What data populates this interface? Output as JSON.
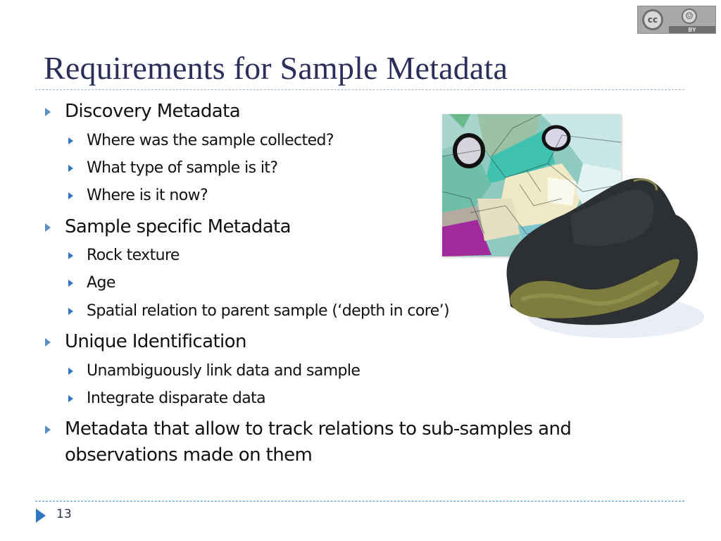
{
  "license_badge": {
    "label": "BY",
    "cc_label": "cc",
    "icon": "creative-commons-by-icon"
  },
  "slide": {
    "title": "Requirements for Sample Metadata",
    "bullets": [
      {
        "level": 1,
        "text": "Discovery Metadata"
      },
      {
        "level": 2,
        "text": "Where was the sample collected?"
      },
      {
        "level": 2,
        "text": "What type of sample is it?"
      },
      {
        "level": 2,
        "text": "Where is it now?"
      },
      {
        "level": 1,
        "text": "Sample specific Metadata"
      },
      {
        "level": 2,
        "text": "Rock texture"
      },
      {
        "level": 2,
        "text": "Age"
      },
      {
        "level": 2,
        "text": "Spatial relation to parent sample (‘depth in core’)"
      },
      {
        "level": 1,
        "text": "Unique Identification"
      },
      {
        "level": 2,
        "text": "Unambiguously link data and sample"
      },
      {
        "level": 2,
        "text": "Integrate disparate data"
      },
      {
        "level": 1,
        "text": "Metadata that allow to track relations to sub-samples and"
      },
      {
        "level": 1,
        "text": "observations made on them",
        "continuation": true
      }
    ],
    "images": [
      {
        "name": "thin-section-micrograph",
        "description": "Colorful polarized-light thin section of rock"
      },
      {
        "name": "rock-sample-photo",
        "description": "Dark rock sample with olive-green mineral inclusion"
      }
    ],
    "page_number": "13"
  },
  "colors": {
    "title": "#2b2d5a",
    "bullet_arrow": "#5b8fc4",
    "rule_top": "#9ab3c6",
    "rule_bottom": "#3d8bc9"
  }
}
